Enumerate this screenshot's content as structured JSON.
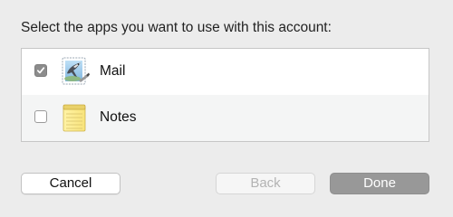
{
  "dialog": {
    "prompt": "Select the apps you want to use with this account:"
  },
  "apps": [
    {
      "label": "Mail",
      "checked": true,
      "icon": "mail-icon"
    },
    {
      "label": "Notes",
      "checked": false,
      "icon": "notes-icon"
    }
  ],
  "buttons": {
    "cancel": "Cancel",
    "back": "Back",
    "done": "Done"
  },
  "colors": {
    "window_background": "#ececec",
    "checkbox_checked": "#8c8c8c",
    "done_button": "#989898"
  }
}
